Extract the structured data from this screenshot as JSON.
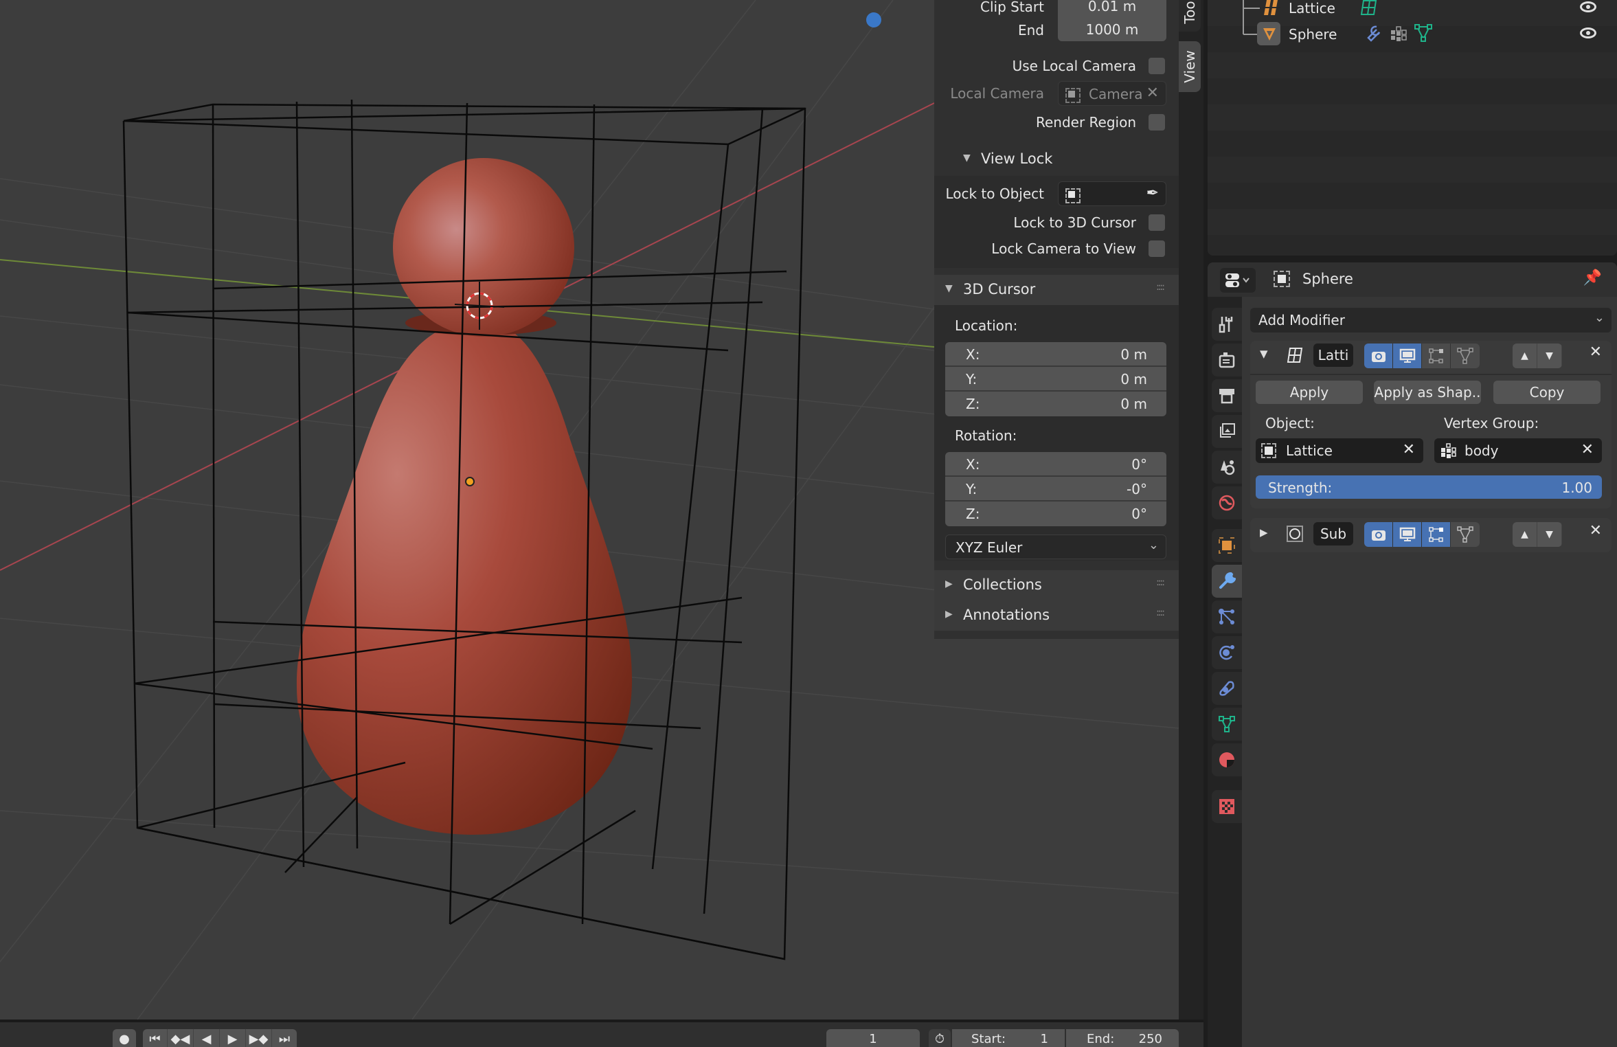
{
  "viewport": {
    "object_color": "#b24a3a",
    "axis_x_color": "#a8454f",
    "axis_y_color": "#7a9a3a",
    "gizmo_dot_color": "#3a78c8"
  },
  "view_panel": {
    "clip_start_label": "Clip Start",
    "clip_start_value": "0.01 m",
    "clip_end_label": "End",
    "clip_end_value": "1000 m",
    "use_local_camera_label": "Use Local Camera",
    "use_local_camera": false,
    "local_camera_label": "Local Camera",
    "local_camera_value": "Camera",
    "render_region_label": "Render Region",
    "render_region": false
  },
  "view_lock": {
    "title": "View Lock",
    "lock_to_object_label": "Lock to Object",
    "lock_to_object_value": "",
    "lock_to_cursor_label": "Lock to 3D Cursor",
    "lock_to_cursor": false,
    "lock_camera_label": "Lock Camera to View",
    "lock_camera": false
  },
  "cursor_panel": {
    "title": "3D Cursor",
    "location_label": "Location:",
    "location": [
      {
        "axis": "X:",
        "value": "0 m"
      },
      {
        "axis": "Y:",
        "value": "0 m"
      },
      {
        "axis": "Z:",
        "value": "0 m"
      }
    ],
    "rotation_label": "Rotation:",
    "rotation": [
      {
        "axis": "X:",
        "value": "0°"
      },
      {
        "axis": "Y:",
        "value": "-0°"
      },
      {
        "axis": "Z:",
        "value": "0°"
      }
    ],
    "rotation_mode": "XYZ Euler"
  },
  "collapsed_panels": [
    "Collections",
    "Annotations"
  ],
  "sidebar_tabs": [
    "Tool",
    "View"
  ],
  "sidebar_tab_labels": {
    "tool": "Too",
    "view": "View"
  },
  "outliner": {
    "items": [
      {
        "name": "Lattice",
        "type": "lattice",
        "visible": true
      },
      {
        "name": "Sphere",
        "type": "mesh",
        "visible": true
      }
    ]
  },
  "properties": {
    "object_name": "Sphere",
    "add_modifier_label": "Add Modifier",
    "modifiers": [
      {
        "name": "Latti",
        "type": "lattice",
        "expanded": true,
        "apply_label": "Apply",
        "apply_shape_label": "Apply as Shap..",
        "copy_label": "Copy",
        "object_label": "Object:",
        "object_value": "Lattice",
        "vgroup_label": "Vertex Group:",
        "vgroup_value": "body",
        "strength_label": "Strength:",
        "strength_value": "1.00",
        "render": true,
        "viewport": true,
        "editmode": false,
        "cage": false
      },
      {
        "name": "Sub",
        "type": "subdivision",
        "expanded": false,
        "render": true,
        "viewport": true,
        "editmode": true,
        "cage": false
      }
    ]
  },
  "timeline": {
    "current_frame": "1",
    "start_label": "Start:",
    "start_value": "1",
    "end_label": "End:",
    "end_value": "250"
  }
}
